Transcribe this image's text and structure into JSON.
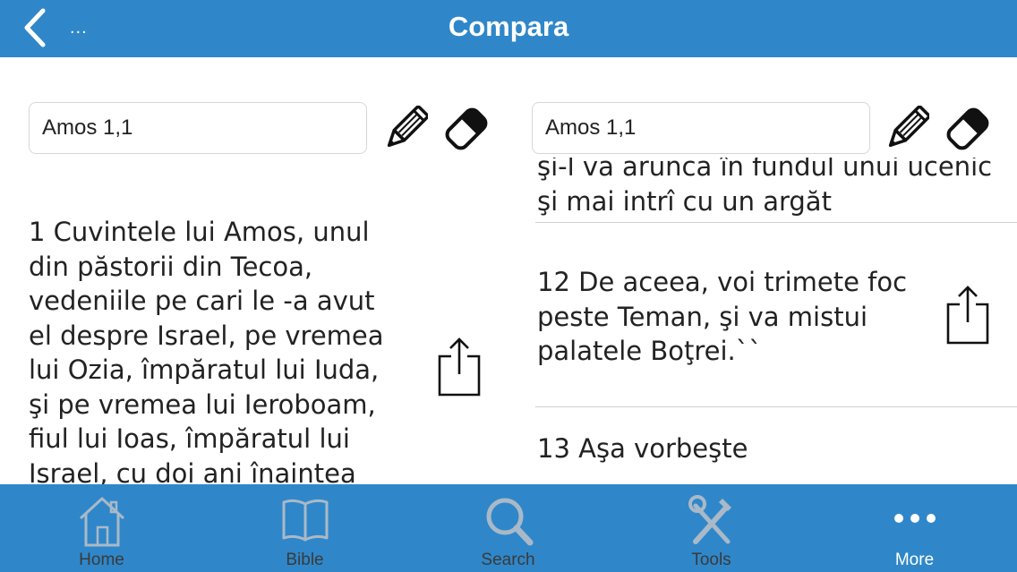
{
  "header": {
    "title": "Compara",
    "breadcrumb": "..."
  },
  "left_pane": {
    "reference": "Amos 1,1",
    "verse_text": "1 Cuvintele lui Amos, unul\ndin păstorii din Tecoa,\nvedeniile pe cari le -a avut\nel despre Israel, pe vremea\nlui Ozia, împăratul lui Iuda,\nşi pe vremea lui Ieroboam,\nfiul lui Ioas, împăratul lui\nIsrael, cu doi ani înaintea"
  },
  "right_pane": {
    "reference": "Amos 1,1",
    "verses": [
      {
        "text": "şi-l va arunca în fundul unui ucenic\nşi mai intrî cu un argăt"
      },
      {
        "text": "12 De aceea, voi trimete foc\npeste Teman, şi va mistui\npalatele Boţrei.``"
      },
      {
        "text": "13 Aşa vorbeşte"
      }
    ]
  },
  "tabbar": {
    "tabs": [
      {
        "label": "Home",
        "icon": "home-icon"
      },
      {
        "label": "Bible",
        "icon": "book-icon"
      },
      {
        "label": "Search",
        "icon": "search-icon"
      },
      {
        "label": "Tools",
        "icon": "tools-icon"
      },
      {
        "label": "More",
        "icon": "more-icon",
        "active": true
      }
    ]
  },
  "colors": {
    "accent": "#2f87c9",
    "tab_icon_inactive": "#a9b9c8",
    "tab_label_inactive": "#3a3a3a",
    "active": "#ffffff"
  }
}
